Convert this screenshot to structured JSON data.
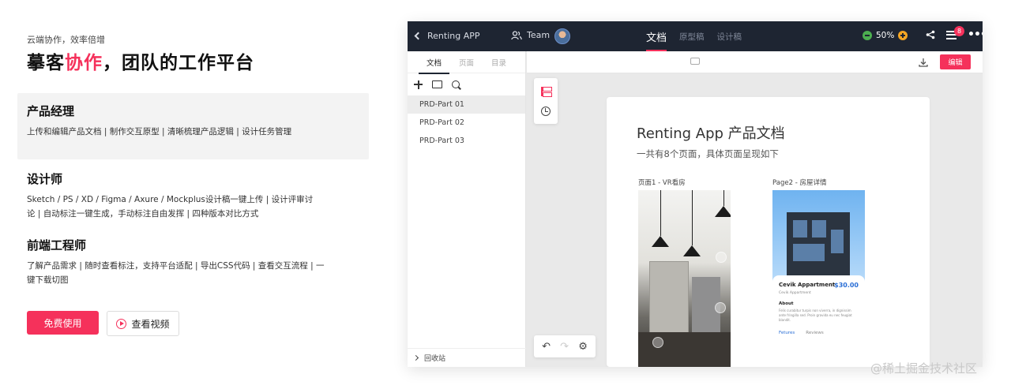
{
  "hero": {
    "eyebrow": "云端协作，效率倍增",
    "title_prefix": "摹客",
    "title_accent": "协作",
    "title_suffix": "，团队的工作平台",
    "accent_color": "#f5315b"
  },
  "roles": [
    {
      "title": "产品经理",
      "desc": "上传和编辑产品文档 | 制作交互原型 | 清晰梳理产品逻辑 | 设计任务管理",
      "active": true
    },
    {
      "title": "设计师",
      "desc": "Sketch / PS / XD / Figma / Axure / Mockplus设计稿一键上传 | 设计评审讨论 | 自动标注一键生成，手动标注自由发挥 | 四种版本对比方式",
      "active": false
    },
    {
      "title": "前端工程师",
      "desc": "了解产品需求 | 随时查看标注，支持平台适配 | 导出CSS代码 | 查看交互流程 | 一键下载切图",
      "active": false
    }
  ],
  "cta": {
    "primary": "免费使用",
    "secondary": "查看视频",
    "secondary_icon": "play-circle-icon"
  },
  "app": {
    "back_label": "Renting APP",
    "team_label": "Team",
    "top_tabs": [
      {
        "label": "文档",
        "active": true
      },
      {
        "label": "原型稿",
        "active": false
      },
      {
        "label": "设计稿",
        "active": false
      }
    ],
    "zoom": "50%",
    "notification_count": "8",
    "side_tabs": [
      {
        "label": "文档",
        "active": true
      },
      {
        "label": "页面",
        "active": false
      },
      {
        "label": "目录",
        "active": false
      }
    ],
    "docs": [
      {
        "label": "PRD-Part 01",
        "active": true
      },
      {
        "label": "PRD-Part 02",
        "active": false
      },
      {
        "label": "PRD-Part 03",
        "active": false
      }
    ],
    "trash_label": "回收站",
    "edit_button": "编辑",
    "doc": {
      "title": "Renting App 产品文档",
      "subtitle": "一共有8个页面，具体页面呈现如下",
      "page1_label": "页面1 - VR看房",
      "page2_label": "Page2 - 房屋详情"
    },
    "phone2": {
      "name": "Cevik Appartment",
      "price": "$30.00",
      "location": "Cevik Appartment",
      "about_title": "About",
      "about_text": "Felis curabitur turpis non viverra, in dignissim ante fringilla sed. Proin gravida eu nec feugiat blandit.",
      "tab_active": "Fetures",
      "tab_other": "Reviews"
    }
  },
  "watermark": "@稀土掘金技术社区"
}
